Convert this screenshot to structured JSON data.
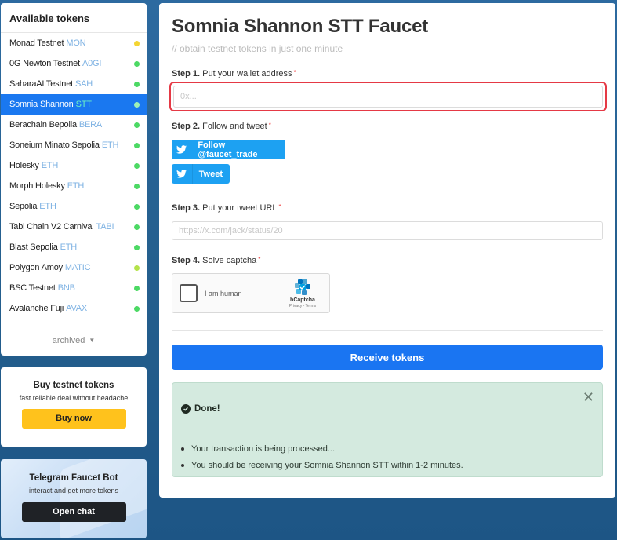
{
  "sidebar": {
    "title": "Available tokens",
    "tokens": [
      {
        "name": "Monad Testnet",
        "symbol": "MON",
        "status": "yellow"
      },
      {
        "name": "0G Newton Testnet",
        "symbol": "A0GI",
        "status": "green"
      },
      {
        "name": "SaharaAI Testnet",
        "symbol": "SAH",
        "status": "green"
      },
      {
        "name": "Somnia Shannon",
        "symbol": "STT",
        "status": "green",
        "active": true
      },
      {
        "name": "Berachain Bepolia",
        "symbol": "BERA",
        "status": "green"
      },
      {
        "name": "Soneium Minato Sepolia",
        "symbol": "ETH",
        "status": "green"
      },
      {
        "name": "Holesky",
        "symbol": "ETH",
        "status": "green"
      },
      {
        "name": "Morph Holesky",
        "symbol": "ETH",
        "status": "green"
      },
      {
        "name": "Sepolia",
        "symbol": "ETH",
        "status": "green"
      },
      {
        "name": "Tabi Chain V2 Carnival",
        "symbol": "TABI",
        "status": "green"
      },
      {
        "name": "Blast Sepolia",
        "symbol": "ETH",
        "status": "green"
      },
      {
        "name": "Polygon Amoy",
        "symbol": "MATIC",
        "status": "lime"
      },
      {
        "name": "BSC Testnet",
        "symbol": "BNB",
        "status": "green"
      },
      {
        "name": "Avalanche Fuji",
        "symbol": "AVAX",
        "status": "green"
      }
    ],
    "archived_label": "archived"
  },
  "promo_buy": {
    "title": "Buy testnet tokens",
    "subtitle": "fast reliable deal without headache",
    "button": "Buy now"
  },
  "promo_telegram": {
    "title": "Telegram Faucet Bot",
    "subtitle": "interact and get more tokens",
    "button": "Open chat"
  },
  "main": {
    "title": "Somnia Shannon STT Faucet",
    "subtitle": "// obtain testnet tokens in just one minute",
    "step1": {
      "num": "Step 1.",
      "text": " Put your wallet address",
      "placeholder": "0x..."
    },
    "step2": {
      "num": "Step 2.",
      "text": " Follow and tweet",
      "follow_button": "Follow @faucet_trade",
      "tweet_button": "Tweet"
    },
    "step3": {
      "num": "Step 3.",
      "text": " Put your tweet URL",
      "placeholder": "https://x.com/jack/status/20"
    },
    "step4": {
      "num": "Step 4.",
      "text": " Solve captcha"
    },
    "captcha": {
      "label": "I am human",
      "brand": "hCaptcha",
      "links": "Privacy - Terms"
    },
    "receive_button": "Receive tokens",
    "alert": {
      "title": "Done!",
      "messages": [
        "Your transaction is being processed...",
        "You should be receiving your Somnia Shannon STT within 1-2 minutes."
      ]
    }
  },
  "colors": {
    "accent": "#1a75f2",
    "twitter": "#1da1f2",
    "buy": "#ffc21c",
    "success_bg": "#d4eadf",
    "highlight": "#e53945"
  }
}
